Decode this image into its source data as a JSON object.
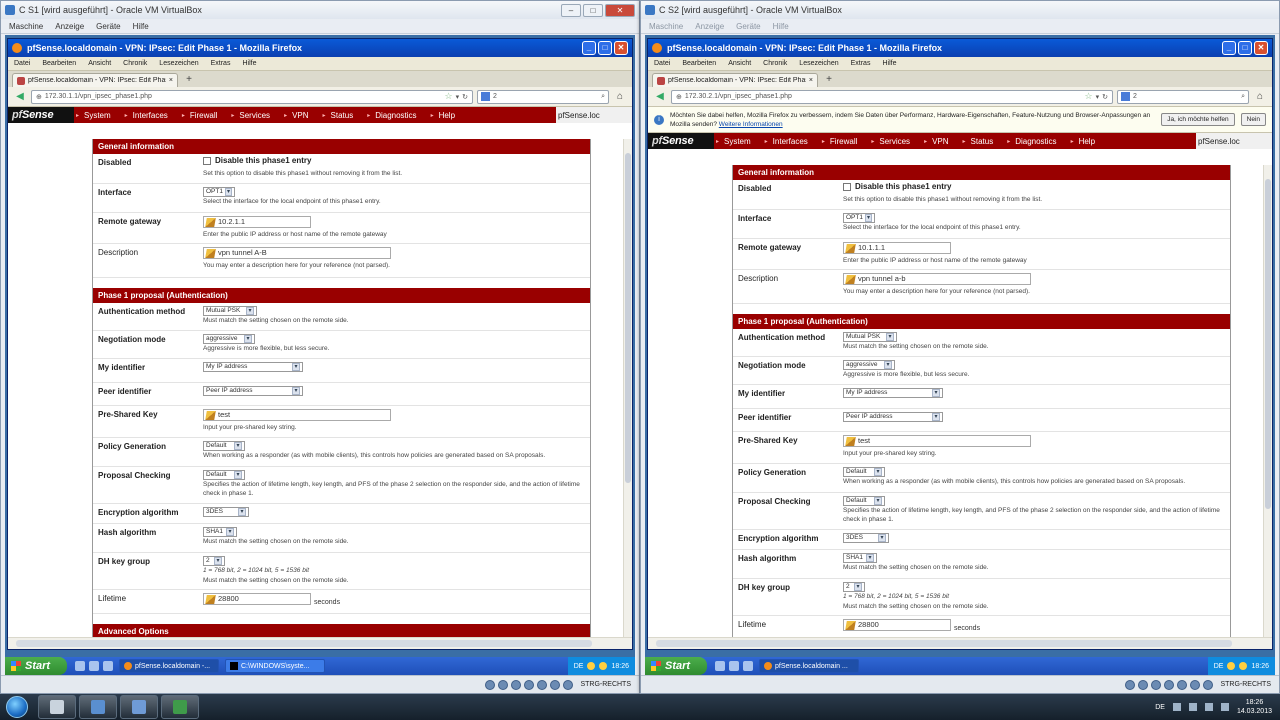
{
  "vms": [
    {
      "title": "C S1 [wird ausgeführt] - Oracle VM VirtualBox",
      "menu": [
        "Maschine",
        "Anzeige",
        "Geräte",
        "Hilfe"
      ],
      "host_key": "STRG-RECHTS",
      "firefox": {
        "title": "pfSense.localdomain - VPN: IPsec: Edit Phase 1 - Mozilla Firefox",
        "menu": [
          "Datei",
          "Bearbeiten",
          "Ansicht",
          "Chronik",
          "Lesezeichen",
          "Extras",
          "Hilfe"
        ],
        "tab": "pfSense.localdomain - VPN: IPsec: Edit Phas...",
        "url": "172.30.1.1/vpn_ipsec_phase1.php",
        "search": "2",
        "pf_nav": [
          "System",
          "Interfaces",
          "Firewall",
          "Services",
          "VPN",
          "Status",
          "Diagnostics",
          "Help"
        ],
        "pf_host": "pfSense.loc",
        "sections": {
          "general": "General information",
          "phase1": "Phase 1 proposal (Authentication)",
          "advanced": "Advanced Options"
        },
        "fields": {
          "disabled": {
            "label": "Disabled",
            "check": "Disable this phase1 entry",
            "help": "Set this option to disable this phase1 without removing it from the list."
          },
          "interface": {
            "label": "Interface",
            "value": "OPT1",
            "help": "Select the interface for the local endpoint of this phase1 entry."
          },
          "remote_gateway": {
            "label": "Remote gateway",
            "value": "10.2.1.1",
            "help": "Enter the public IP address or host name of the remote gateway"
          },
          "description": {
            "label": "Description",
            "value": "vpn tunnel A-B",
            "help": "You may enter a description here for your reference (not parsed)."
          },
          "auth_method": {
            "label": "Authentication method",
            "value": "Mutual PSK",
            "help": "Must match the setting chosen on the remote side."
          },
          "negotiation": {
            "label": "Negotiation mode",
            "value": "aggressive",
            "help": "Aggressive is more flexible, but less secure."
          },
          "my_id": {
            "label": "My identifier",
            "value": "My IP address"
          },
          "peer_id": {
            "label": "Peer identifier",
            "value": "Peer IP address"
          },
          "psk": {
            "label": "Pre-Shared Key",
            "value": "test",
            "help": "Input your pre-shared key string."
          },
          "policy_gen": {
            "label": "Policy Generation",
            "value": "Default",
            "help": "When working as a responder (as with mobile clients), this controls how policies are generated based on SA proposals."
          },
          "proposal_check": {
            "label": "Proposal Checking",
            "value": "Default",
            "help": "Specifies the action of lifetime length, key length, and PFS of the phase 2 selection on the responder side, and the action of lifetime check in phase 1."
          },
          "enc_alg": {
            "label": "Encryption algorithm",
            "value": "3DES"
          },
          "hash_alg": {
            "label": "Hash algorithm",
            "value": "SHA1",
            "help": "Must match the setting chosen on the remote side."
          },
          "dh_group": {
            "label": "DH key group",
            "value": "2",
            "help_italic": "1 = 768 bit, 2 = 1024 bit, 5 = 1536 bit",
            "help": "Must match the setting chosen on the remote side."
          },
          "lifetime": {
            "label": "Lifetime",
            "value": "28800",
            "suffix": "seconds"
          }
        }
      },
      "xp_taskbar": {
        "start": "Start",
        "tasks": [
          "pfSense.localdomain -...",
          "C:\\WINDOWS\\syste..."
        ],
        "lang": "DE",
        "time": "18:26"
      }
    },
    {
      "title": "C S2 [wird ausgeführt] - Oracle VM VirtualBox",
      "menu": [
        "Maschine",
        "Anzeige",
        "Geräte",
        "Hilfe"
      ],
      "host_key": "STRG-RECHTS",
      "firefox": {
        "title": "pfSense.localdomain - VPN: IPsec: Edit Phase 1 - Mozilla Firefox",
        "menu": [
          "Datei",
          "Bearbeiten",
          "Ansicht",
          "Chronik",
          "Lesezeichen",
          "Extras",
          "Hilfe"
        ],
        "tab": "pfSense.localdomain - VPN: IPsec: Edit Phas...",
        "url": "172.30.2.1/vpn_ipsec_phase1.php",
        "search": "2",
        "notification": {
          "message": "Möchten Sie dabei helfen, Mozilla Firefox zu verbessern, indem Sie Daten über Performanz, Hardware-Eigenschaften, Feature-Nutzung und Browser-Anpassungen an Mozilla senden?",
          "link": "Weitere Informationen",
          "accept": "Ja, ich möchte helfen",
          "decline": "Nein"
        },
        "pf_nav": [
          "System",
          "Interfaces",
          "Firewall",
          "Services",
          "VPN",
          "Status",
          "Diagnostics",
          "Help"
        ],
        "pf_host": "pfSense.loc",
        "sections": {
          "general": "General information",
          "phase1": "Phase 1 proposal (Authentication)"
        },
        "fields": {
          "disabled": {
            "label": "Disabled",
            "check": "Disable this phase1 entry",
            "help": "Set this option to disable this phase1 without removing it from the list."
          },
          "interface": {
            "label": "Interface",
            "value": "OPT1",
            "help": "Select the interface for the local endpoint of this phase1 entry."
          },
          "remote_gateway": {
            "label": "Remote gateway",
            "value": "10.1.1.1",
            "help": "Enter the public IP address or host name of the remote gateway"
          },
          "description": {
            "label": "Description",
            "value": "vpn tunnel a-b",
            "help": "You may enter a description here for your reference (not parsed)."
          },
          "auth_method": {
            "label": "Authentication method",
            "value": "Mutual PSK",
            "help": "Must match the setting chosen on the remote side."
          },
          "negotiation": {
            "label": "Negotiation mode",
            "value": "aggressive",
            "help": "Aggressive is more flexible, but less secure."
          },
          "my_id": {
            "label": "My identifier",
            "value": "My IP address"
          },
          "peer_id": {
            "label": "Peer identifier",
            "value": "Peer IP address"
          },
          "psk": {
            "label": "Pre-Shared Key",
            "value": "test",
            "help": "Input your pre-shared key string."
          },
          "policy_gen": {
            "label": "Policy Generation",
            "value": "Default",
            "help": "When working as a responder (as with mobile clients), this controls how policies are generated based on SA proposals."
          },
          "proposal_check": {
            "label": "Proposal Checking",
            "value": "Default",
            "help": "Specifies the action of lifetime length, key length, and PFS of the phase 2 selection on the responder side, and the action of lifetime check in phase 1."
          },
          "enc_alg": {
            "label": "Encryption algorithm",
            "value": "3DES"
          },
          "hash_alg": {
            "label": "Hash algorithm",
            "value": "SHA1",
            "help": "Must match the setting chosen on the remote side."
          },
          "dh_group": {
            "label": "DH key group",
            "value": "2",
            "help_italic": "1 = 768 bit, 2 = 1024 bit, 5 = 1536 bit",
            "help": "Must match the setting chosen on the remote side."
          },
          "lifetime": {
            "label": "Lifetime",
            "value": "28800",
            "suffix": "seconds"
          }
        }
      },
      "xp_taskbar": {
        "start": "Start",
        "tasks": [
          "pfSense.localdomain ..."
        ],
        "lang": "DE",
        "time": "18:26"
      }
    }
  ],
  "host_taskbar": {
    "lang": "DE",
    "time": "18:26",
    "date": "14.03.2013"
  }
}
